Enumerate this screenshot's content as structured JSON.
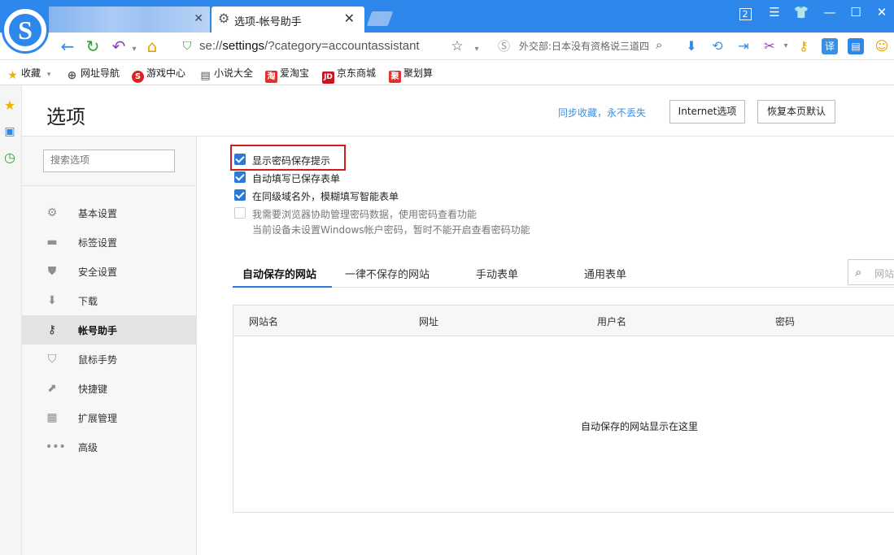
{
  "browser": {
    "active_tab_title": "选项-帐号助手",
    "tab_count_badge": "2",
    "url_prefix": "se://",
    "url_host": "settings",
    "url_path": "/?category=accountassistant",
    "search_text": "外交部:日本没有资格说三道四",
    "logo_letter": "S"
  },
  "bookmarks": [
    {
      "label": "收藏",
      "icon": "star-icon",
      "color": "#f0b400"
    },
    {
      "label": "网址导航",
      "icon": "globe-icon",
      "color": "#555555"
    },
    {
      "label": "游戏中心",
      "icon": "game-icon",
      "color": "#e02020"
    },
    {
      "label": "小说大全",
      "icon": "book-icon",
      "color": "#555555"
    },
    {
      "label": "爱淘宝",
      "icon": "taobao-icon",
      "color": "#e0322f"
    },
    {
      "label": "京东商城",
      "icon": "jd-icon",
      "color": "#c81623"
    },
    {
      "label": "聚划算",
      "icon": "juhuasuan-icon",
      "color": "#e0322f"
    }
  ],
  "bookmark_glyphs": {
    "taobao": "淘",
    "jd": "JD",
    "juhuasuan": "聚"
  },
  "header": {
    "title": "选项",
    "sync_link": "同步收藏，永不丢失",
    "internet_options": "Internet选项",
    "restore_defaults": "恢复本页默认"
  },
  "sidebar": {
    "search_placeholder": "搜索选项",
    "items": [
      {
        "label": "基本设置",
        "icon": "gear-icon"
      },
      {
        "label": "标签设置",
        "icon": "tab-icon"
      },
      {
        "label": "安全设置",
        "icon": "shield-check-icon"
      },
      {
        "label": "下载",
        "icon": "download-icon"
      },
      {
        "label": "帐号助手",
        "icon": "key-icon",
        "active": true
      },
      {
        "label": "鼠标手势",
        "icon": "mouse-shield-icon"
      },
      {
        "label": "快捷键",
        "icon": "shortcut-arrow-icon"
      },
      {
        "label": "扩展管理",
        "icon": "grid-icon"
      },
      {
        "label": "高级",
        "icon": "more-dots-icon"
      }
    ]
  },
  "options": {
    "show_password_prompt": {
      "label": "显示密码保存提示",
      "checked": true
    },
    "autofill_forms": {
      "label": "自动填写已保存表单",
      "checked": true
    },
    "fuzzy_fill": {
      "label": "在同级域名外，模糊填写智能表单",
      "checked": true
    },
    "manage_passwords": {
      "label": "我需要浏览器协助管理密码数据，使用密码查看功能",
      "checked": false
    },
    "note": "当前设备未设置Windows帐户密码，暂时不能开启查看密码功能"
  },
  "content_tabs": [
    "自动保存的网站",
    "一律不保存的网站",
    "手动表单",
    "通用表单"
  ],
  "content_search_placeholder": "网站",
  "table": {
    "columns": [
      "网站名",
      "网址",
      "用户名",
      "密码"
    ],
    "empty_message": "自动保存的网站显示在这里"
  },
  "colors": {
    "accent": "#2b79d6",
    "titlebar": "#2e87eb",
    "highlight": "#d21c1c",
    "link": "#3a8fe0"
  }
}
